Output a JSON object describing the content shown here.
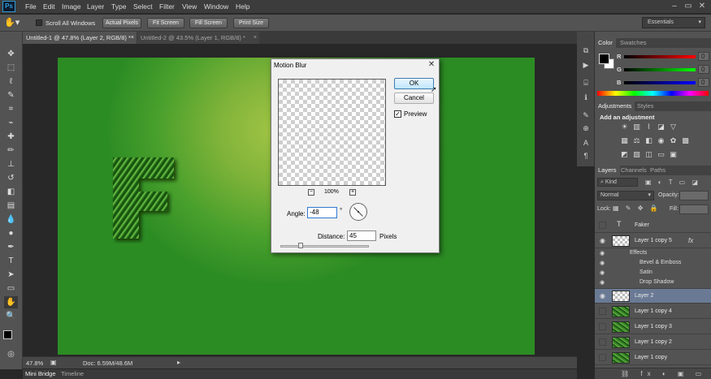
{
  "app": {
    "logo_text": "Ps",
    "accent": "#2f9bd6"
  },
  "menubar": {
    "items": [
      "File",
      "Edit",
      "Image",
      "Layer",
      "Type",
      "Select",
      "Filter",
      "View",
      "Window",
      "Help"
    ]
  },
  "options_bar": {
    "scroll_all_windows_label": "Scroll All Windows",
    "scroll_all_windows_checked": false,
    "buttons": [
      "Actual Pixels",
      "Fit Screen",
      "Fill Screen",
      "Print Size"
    ],
    "workspace": "Essentials"
  },
  "document_tabs": [
    {
      "label": "Untitled-1 @ 47.8% (Layer 2, RGB/8) *",
      "active": true
    },
    {
      "label": "Untitled-2 @ 43.5% (Layer 1, RGB/8) *",
      "active": false
    }
  ],
  "status_bar": {
    "zoom": "47.8%",
    "doc_size": "Doc: 6.59M/48.6M"
  },
  "bottom_tabs": [
    "Mini Bridge",
    "Timeline"
  ],
  "canvas": {
    "letter": "F",
    "bg_center": "#a2c545",
    "bg_edge": "#2c8c24"
  },
  "panels": {
    "color_tabs": [
      "Color",
      "Swatches"
    ],
    "color_sliders": [
      {
        "label": "R",
        "value": "0"
      },
      {
        "label": "G",
        "value": "0"
      },
      {
        "label": "B",
        "value": "0"
      }
    ],
    "adjustment_tabs": [
      "Adjustments",
      "Styles"
    ],
    "adjustments_title": "Add an adjustment",
    "layer_tabs": [
      "Layers",
      "Channels",
      "Paths"
    ],
    "kind_label": "Kind",
    "blend_mode": "Normal",
    "opacity_label": "Opacity:",
    "lock_label": "Lock:",
    "fill_label": "Fill:",
    "layers": [
      {
        "name": "Faker",
        "type": "text",
        "visible": false,
        "selected": false
      },
      {
        "name": "Layer 1 copy 5",
        "type": "checker",
        "visible": true,
        "selected": false,
        "fx": "fx"
      },
      {
        "name": "Effects",
        "type": "effects-header",
        "visible": true
      },
      {
        "name": "Bevel & Emboss",
        "type": "effect",
        "visible": true
      },
      {
        "name": "Satin",
        "type": "effect",
        "visible": true
      },
      {
        "name": "Drop Shadow",
        "type": "effect",
        "visible": true
      },
      {
        "name": "Layer 2",
        "type": "checker",
        "visible": true,
        "selected": true
      },
      {
        "name": "Layer 1 copy 4",
        "type": "leaf",
        "visible": false,
        "selected": false
      },
      {
        "name": "Layer 1 copy 3",
        "type": "leaf",
        "visible": false,
        "selected": false
      },
      {
        "name": "Layer 1 copy 2",
        "type": "leaf",
        "visible": false,
        "selected": false
      },
      {
        "name": "Layer 1 copy",
        "type": "leaf",
        "visible": false,
        "selected": false
      }
    ]
  },
  "dialog": {
    "title": "Motion Blur",
    "ok_label": "OK",
    "cancel_label": "Cancel",
    "preview_label": "Preview",
    "preview_checked": true,
    "zoom_level": "100%",
    "angle_label": "Angle:",
    "angle_value": "-48",
    "angle_unit": "°",
    "distance_label": "Distance:",
    "distance_value": "45",
    "distance_unit": "Pixels"
  }
}
